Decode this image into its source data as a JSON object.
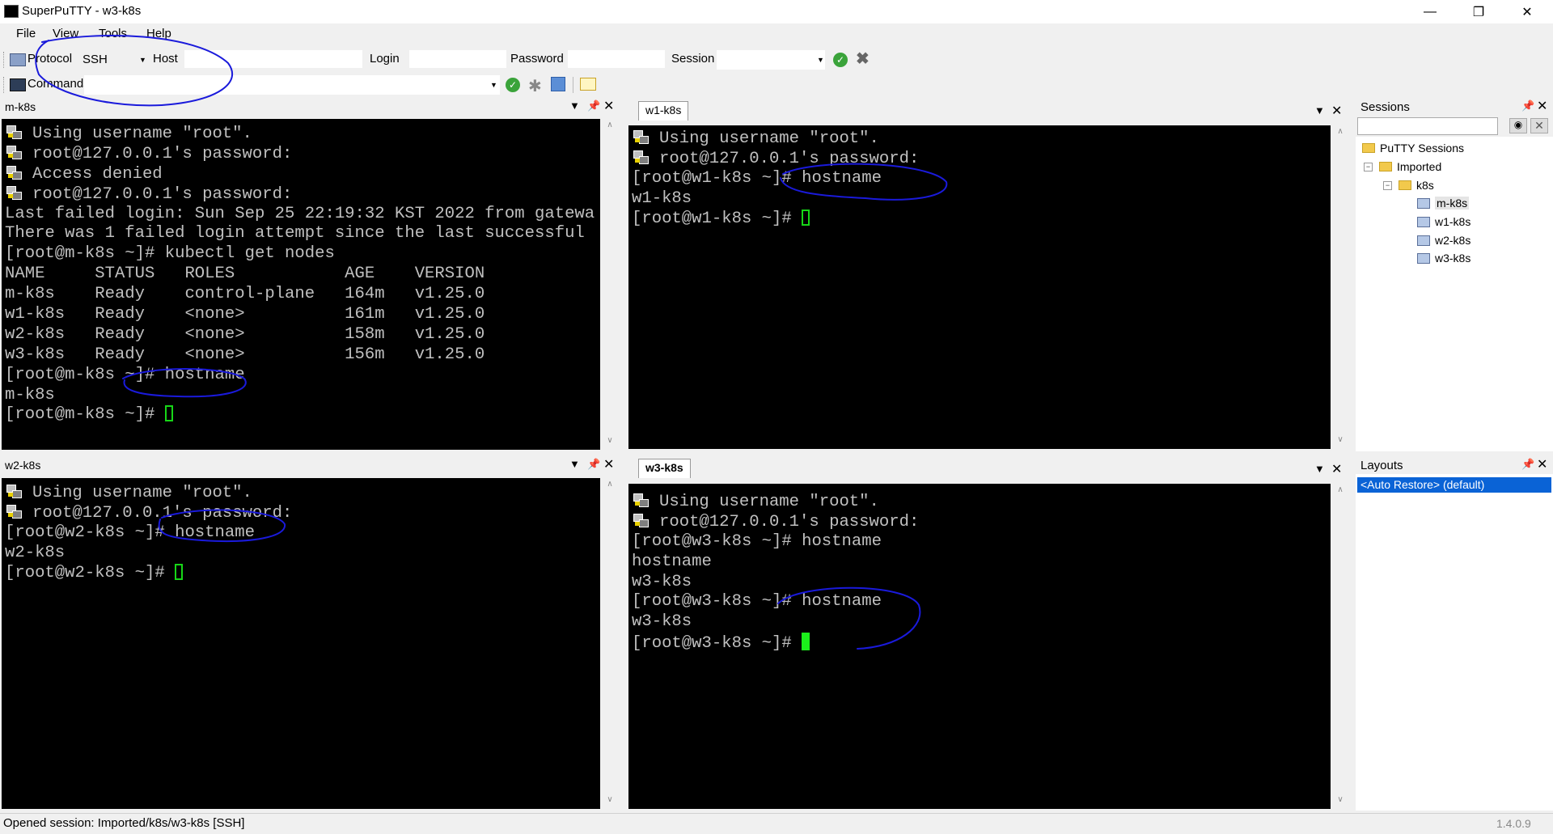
{
  "window": {
    "title": "SuperPuTTY - w3-k8s"
  },
  "menu": [
    "File",
    "View",
    "Tools",
    "Help"
  ],
  "toolbar": {
    "protocol_label": "Protocol",
    "protocol_value": "SSH",
    "host_label": "Host",
    "login_label": "Login",
    "password_label": "Password",
    "session_label": "Session",
    "commands_label": "Commands"
  },
  "panels": {
    "m": {
      "title": "m-k8s",
      "lines": [
        {
          "icon": true,
          "text": "Using username \"root\"."
        },
        {
          "icon": true,
          "text": "root@127.0.0.1's password:"
        },
        {
          "icon": true,
          "text": "Access denied"
        },
        {
          "icon": true,
          "text": "root@127.0.0.1's password:"
        },
        {
          "text": "Last failed login: Sun Sep 25 22:19:32 KST 2022 from gatewa"
        },
        {
          "text": "There was 1 failed login attempt since the last successful"
        },
        {
          "text": "[root@m-k8s ~]# kubectl get nodes"
        },
        {
          "text": "NAME     STATUS   ROLES           AGE    VERSION"
        },
        {
          "text": "m-k8s    Ready    control-plane   164m   v1.25.0"
        },
        {
          "text": "w1-k8s   Ready    <none>          161m   v1.25.0"
        },
        {
          "text": "w2-k8s   Ready    <none>          158m   v1.25.0"
        },
        {
          "text": "w3-k8s   Ready    <none>          156m   v1.25.0"
        },
        {
          "text": "[root@m-k8s ~]# hostname"
        },
        {
          "text": "m-k8s"
        },
        {
          "text": "[root@m-k8s ~]# ",
          "cursor": "hollow"
        }
      ]
    },
    "w1": {
      "title": "w1-k8s",
      "lines": [
        {
          "icon": true,
          "text": "Using username \"root\"."
        },
        {
          "icon": true,
          "text": "root@127.0.0.1's password:"
        },
        {
          "text": "[root@w1-k8s ~]# hostname"
        },
        {
          "text": "w1-k8s"
        },
        {
          "text": "[root@w1-k8s ~]# ",
          "cursor": "hollow"
        }
      ]
    },
    "w2": {
      "title": "w2-k8s",
      "lines": [
        {
          "icon": true,
          "text": "Using username \"root\"."
        },
        {
          "icon": true,
          "text": "root@127.0.0.1's password:"
        },
        {
          "text": "[root@w2-k8s ~]# hostname"
        },
        {
          "text": "w2-k8s"
        },
        {
          "text": "[root@w2-k8s ~]# ",
          "cursor": "hollow"
        }
      ]
    },
    "w3": {
      "title": "w3-k8s",
      "lines": [
        {
          "icon": true,
          "text": "Using username \"root\"."
        },
        {
          "icon": true,
          "text": "root@127.0.0.1's password:"
        },
        {
          "text": "[root@w3-k8s ~]# hostname"
        },
        {
          "text": "hostname"
        },
        {
          "text": "w3-k8s"
        },
        {
          "text": "[root@w3-k8s ~]# hostname"
        },
        {
          "text": "w3-k8s"
        },
        {
          "text": "[root@w3-k8s ~]# ",
          "cursor": "solid"
        }
      ]
    }
  },
  "sessions": {
    "title": "Sessions",
    "root": "PuTTY Sessions",
    "folder": "Imported",
    "subfolder": "k8s",
    "items": [
      "m-k8s",
      "w1-k8s",
      "w2-k8s",
      "w3-k8s"
    ]
  },
  "layouts": {
    "title": "Layouts",
    "items": [
      "<Auto Restore> (default)"
    ]
  },
  "status": {
    "text": "Opened session: Imported/k8s/w3-k8s [SSH]",
    "version": "1.4.0.9"
  },
  "annotation_color": "#1a1adb"
}
